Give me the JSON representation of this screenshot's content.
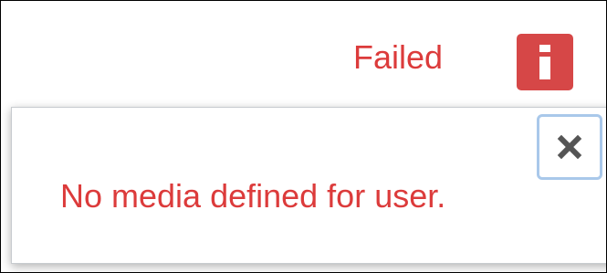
{
  "status": {
    "label": "Failed",
    "color": "#dc3b3b",
    "info_button_color": "#d64747",
    "info_icon": "info-icon"
  },
  "hint": {
    "message": "No media defined for user.",
    "close_icon": "close-icon",
    "close_focus_color": "#a9c8ea"
  }
}
